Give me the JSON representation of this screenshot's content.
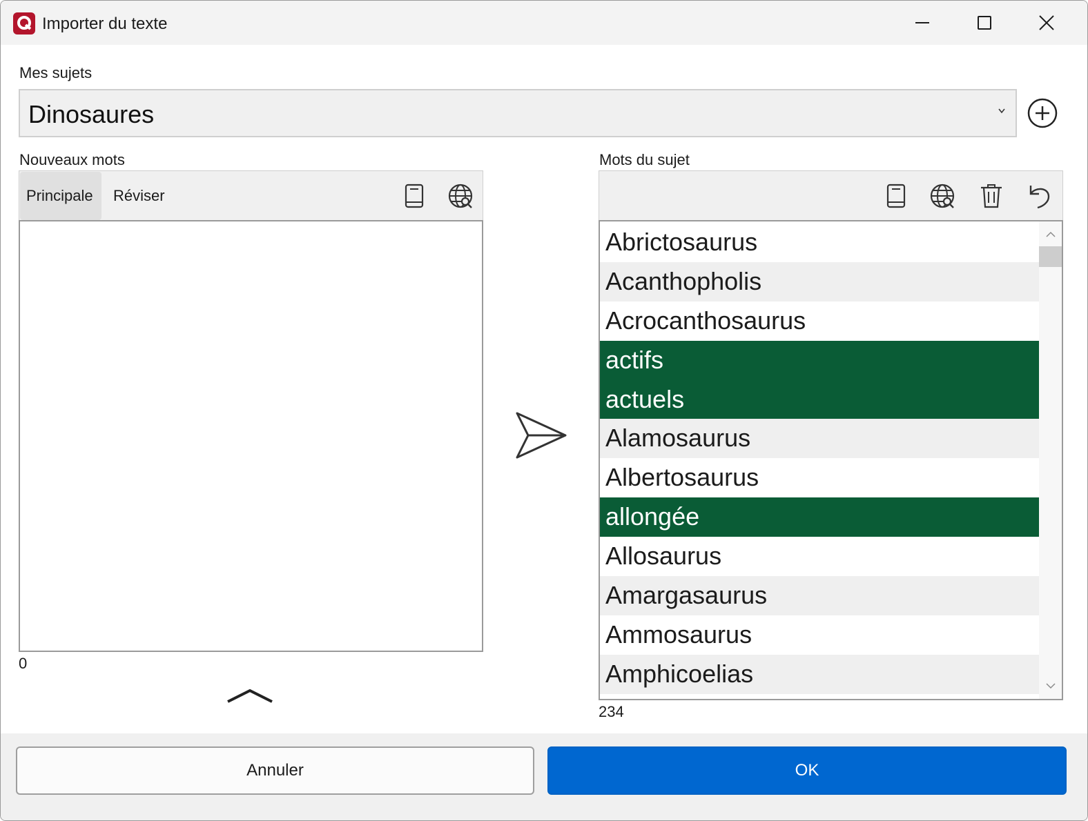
{
  "window": {
    "title": "Importer du texte"
  },
  "subjects": {
    "label": "Mes sujets",
    "selected": "Dinosaures"
  },
  "new_words": {
    "label": "Nouveaux mots",
    "tabs": [
      {
        "label": "Principale",
        "active": true
      },
      {
        "label": "Réviser",
        "active": false
      }
    ],
    "count": "0",
    "icons": [
      "book-icon",
      "globe-search-icon"
    ]
  },
  "subject_words": {
    "label": "Mots du sujet",
    "icons": [
      "book-icon",
      "globe-search-icon",
      "trash-icon",
      "undo-icon"
    ],
    "items": [
      {
        "text": "Abrictosaurus",
        "selected": false
      },
      {
        "text": "Acanthopholis",
        "selected": false
      },
      {
        "text": "Acrocanthosaurus",
        "selected": false
      },
      {
        "text": "actifs",
        "selected": true
      },
      {
        "text": "actuels",
        "selected": true
      },
      {
        "text": "Alamosaurus",
        "selected": false
      },
      {
        "text": "Albertosaurus",
        "selected": false
      },
      {
        "text": "allongée",
        "selected": true
      },
      {
        "text": "Allosaurus",
        "selected": false
      },
      {
        "text": "Amargasaurus",
        "selected": false
      },
      {
        "text": "Ammosaurus",
        "selected": false
      },
      {
        "text": "Amphicoelias",
        "selected": false
      }
    ],
    "count": "234"
  },
  "buttons": {
    "cancel": "Annuler",
    "ok": "OK"
  },
  "colors": {
    "selection": "#0a5c36",
    "primary_button": "#0067d0",
    "app_icon": "#b3152c"
  }
}
